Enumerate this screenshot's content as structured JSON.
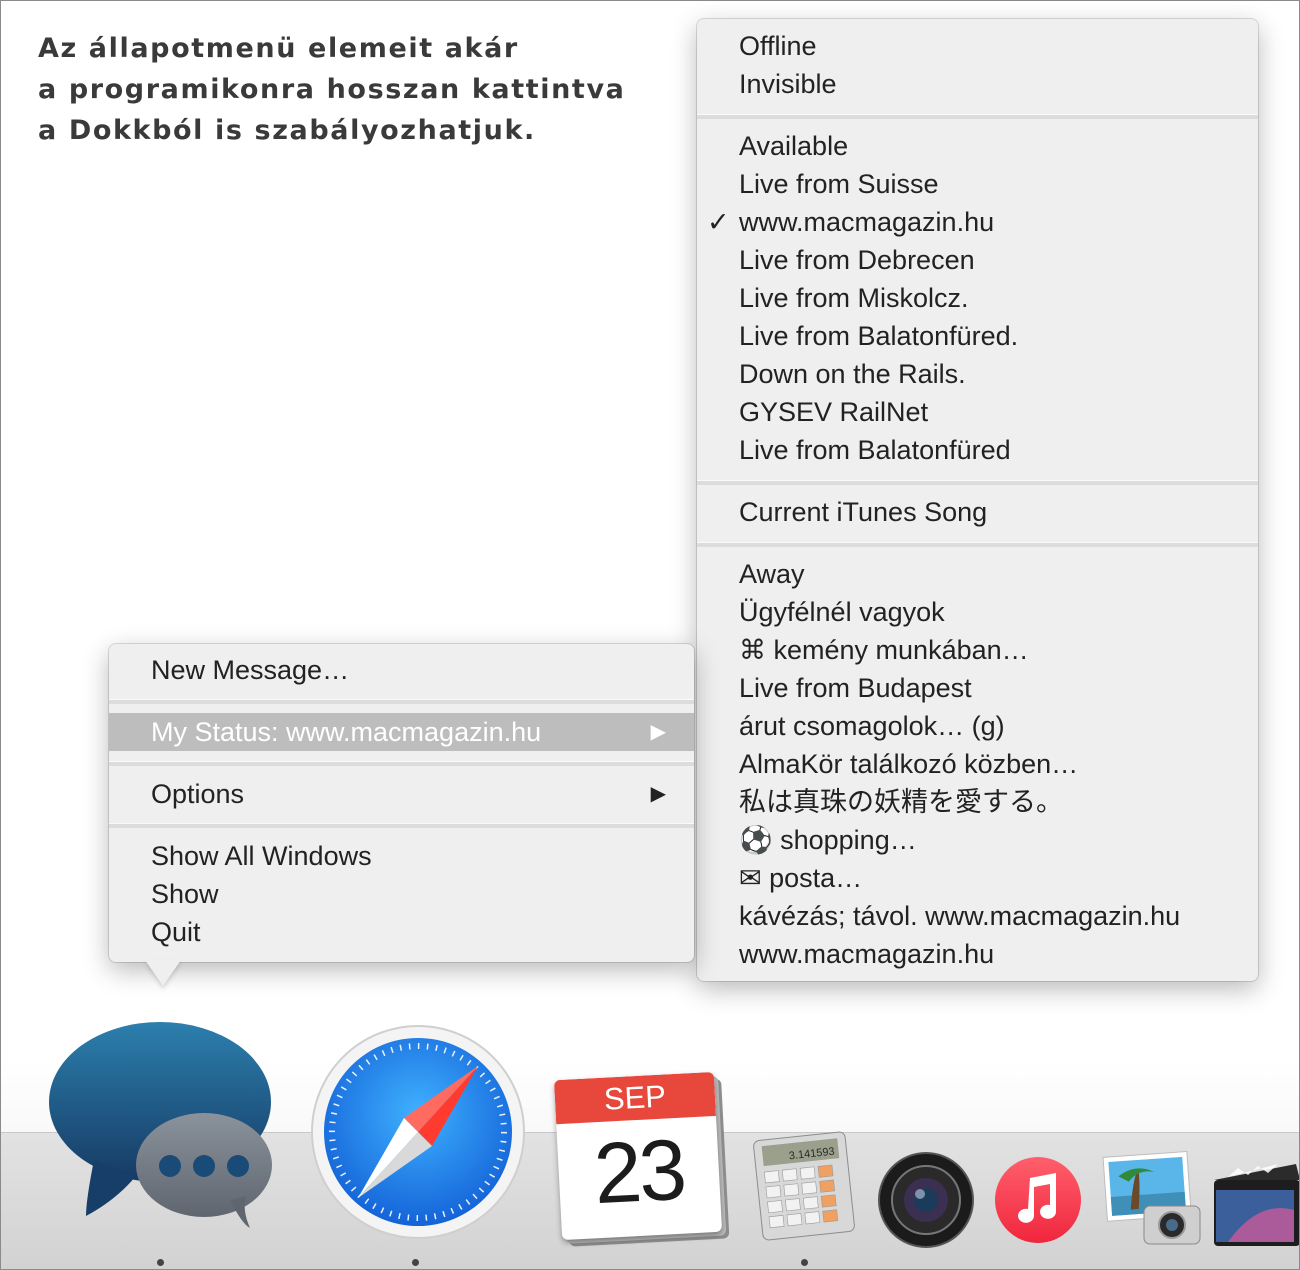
{
  "caption": {
    "line1": "Az állapotmenü elemeit akár",
    "line2": "a programikonra hosszan kattintva",
    "line3": "a Dokkból is szabályozhatjuk."
  },
  "status_menu": {
    "offline": "Offline",
    "invisible": "Invisible",
    "available_items": [
      "Available",
      "Live from Suisse",
      "www.macmagazin.hu",
      "Live from Debrecen",
      "Live from Miskolcz.",
      "Live from Balatonfüred.",
      "Down on the Rails.",
      "GYSEV RailNet",
      "Live from Balatonfüred"
    ],
    "checkmark": "✓",
    "current_itunes": "Current iTunes Song",
    "away_items": [
      "Away",
      "Ügyfélnél vagyok",
      "⌘ kemény munkában…",
      "Live from Budapest",
      "árut csomagolok… (g)",
      "AlmaKör találkozó közben…",
      "私は真珠の妖精を愛する。",
      "⚽ shopping…",
      "✉ posta…",
      "kávézás; távol. www.macmagazin.hu",
      "www.macmagazin.hu"
    ]
  },
  "dock_menu": {
    "new_message": "New Message…",
    "my_status": "My Status: www.macmagazin.hu",
    "options": "Options",
    "show_all_windows": "Show All Windows",
    "show": "Show",
    "quit": "Quit",
    "submenu_arrow": "▶"
  },
  "dock": {
    "calendar_month": "SEP",
    "calendar_day": "23",
    "calculator_display": "3.141593",
    "apps": [
      "messages-icon",
      "safari-icon",
      "calendar-icon",
      "calculator-icon",
      "photo-booth-icon",
      "itunes-icon",
      "iphoto-icon",
      "final-cut-icon"
    ]
  },
  "colors": {
    "menu_bg": "#efefef",
    "highlight": "#bdbdbd",
    "safari_blue": "#1f8ef0",
    "itunes_red": "#fb4155",
    "calendar_red": "#e8473c"
  }
}
